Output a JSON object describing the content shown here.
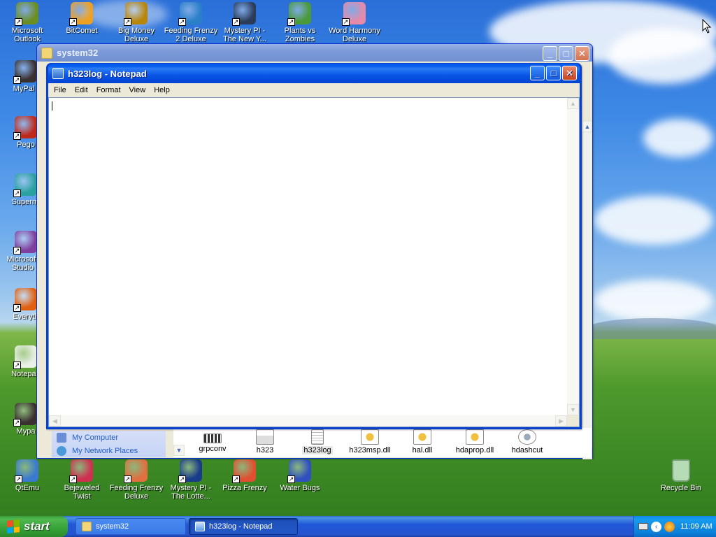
{
  "desktop": {
    "top_icons": [
      {
        "label": "Microsoft Outlook",
        "color": "#6b8e23"
      },
      {
        "label": "BitComet",
        "color": "#f0a020"
      },
      {
        "label": "Big Money Deluxe",
        "color": "#b8860b"
      },
      {
        "label": "Feeding Frenzy 2 Deluxe",
        "color": "#2a80c8"
      },
      {
        "label": "Mystery PI - The New Y...",
        "color": "#2a3c5a"
      },
      {
        "label": "Plants vs Zombies",
        "color": "#4a9a3a"
      },
      {
        "label": "Word Harmony Deluxe",
        "color": "#e58aa8"
      }
    ],
    "left_icons": [
      {
        "label": "MyPal t",
        "color": "#3a3030"
      },
      {
        "label": "Pego",
        "color": "#c0281a"
      },
      {
        "label": "Supermi",
        "color": "#2aa0a0"
      },
      {
        "label": "Microsoft V Studio 2",
        "color": "#8040a0"
      },
      {
        "label": "Everyth",
        "color": "#e06010"
      },
      {
        "label": "Notepad",
        "color": "#e8f0e8"
      },
      {
        "label": "Mypa",
        "color": "#3a3030"
      }
    ],
    "bottom_icons": [
      {
        "label": "QtEmu",
        "color": "#3a7ad0"
      },
      {
        "label": "Bejeweled Twist",
        "color": "#d03050"
      },
      {
        "label": "Feeding Frenzy Deluxe",
        "color": "#e07040"
      },
      {
        "label": "Mystery PI - The Lotte...",
        "color": "#1a3a8a"
      },
      {
        "label": "Pizza Frenzy",
        "color": "#e05030"
      },
      {
        "label": "Water Bugs",
        "color": "#3050c0"
      }
    ],
    "recycle_bin": {
      "label": "Recycle Bin",
      "color": "#a0d0a0"
    }
  },
  "explorer_window": {
    "title": "system32",
    "left_pane": [
      {
        "label": "My Computer"
      },
      {
        "label": "My Network Places"
      }
    ],
    "files": [
      {
        "name": "grpconv"
      },
      {
        "name": "h323"
      },
      {
        "name": "h323log"
      },
      {
        "name": "h323msp.dll"
      },
      {
        "name": "hal.dll"
      },
      {
        "name": "hdaprop.dll"
      },
      {
        "name": "hdashcut"
      }
    ]
  },
  "notepad_window": {
    "title": "h323log - Notepad",
    "menu": [
      "File",
      "Edit",
      "Format",
      "View",
      "Help"
    ],
    "content": ""
  },
  "taskbar": {
    "start_label": "start",
    "tasks": [
      {
        "label": "system32"
      },
      {
        "label": "h323log - Notepad"
      }
    ],
    "clock": "11:09 AM"
  }
}
